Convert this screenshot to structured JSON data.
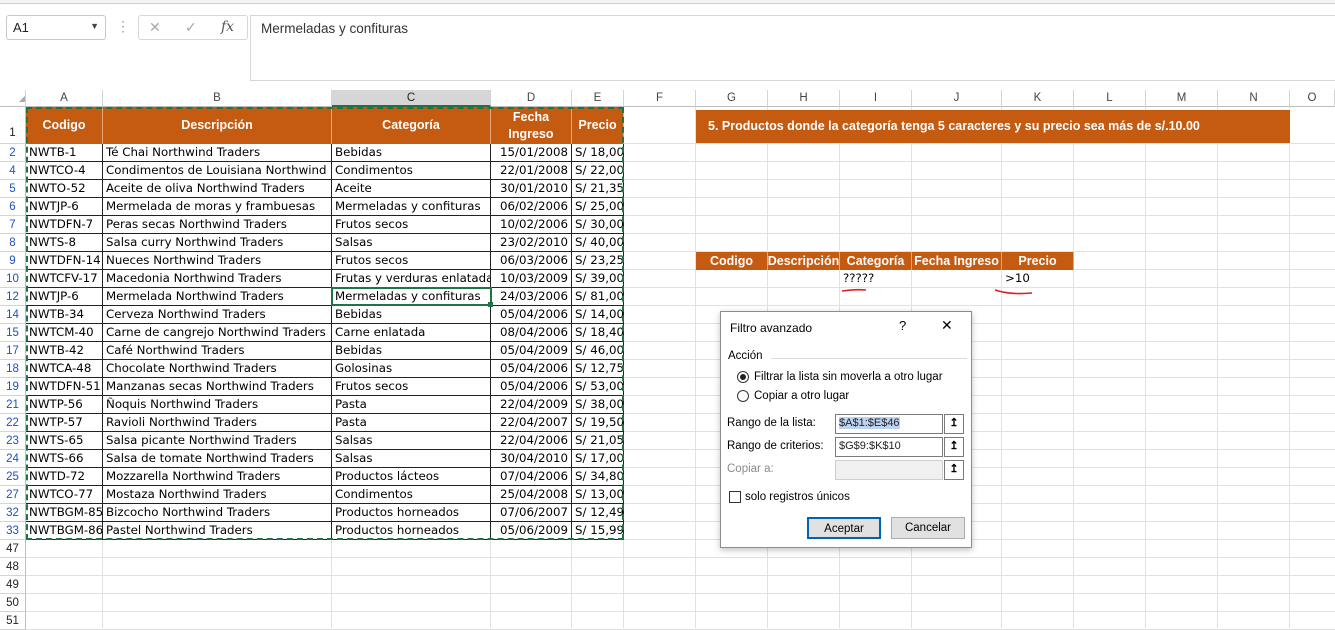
{
  "formula_bar": {
    "name_box": "A1",
    "cancel_icon": "✕",
    "enter_icon": "✓",
    "fx_label": "fx",
    "formula": "Mermeladas y confituras"
  },
  "columns": [
    "A",
    "B",
    "C",
    "D",
    "E",
    "F",
    "G",
    "H",
    "I",
    "J",
    "K",
    "L",
    "M",
    "N",
    "O"
  ],
  "table": {
    "headers": [
      "Codigo",
      "Descripción",
      "Categoría",
      "Fecha Ingreso",
      "Precio"
    ],
    "rows": [
      {
        "row": "2",
        "codigo": "NWTB-1",
        "descripcion": "Té Chai Northwind Traders",
        "categoria": "Bebidas",
        "fecha": "15/01/2008",
        "precio": "S/ 18,00"
      },
      {
        "row": "4",
        "codigo": "NWTCO-4",
        "descripcion": "Condimentos de Louisiana Northwind",
        "categoria": "Condimentos",
        "fecha": "22/01/2008",
        "precio": "S/ 22,00"
      },
      {
        "row": "5",
        "codigo": "NWTO-52",
        "descripcion": "Aceite de oliva Northwind Traders",
        "categoria": "Aceite",
        "fecha": "30/01/2010",
        "precio": "S/ 21,35"
      },
      {
        "row": "6",
        "codigo": "NWTJP-6",
        "descripcion": "Mermelada de moras y frambuesas",
        "categoria": "Mermeladas y confituras",
        "fecha": "06/02/2006",
        "precio": "S/ 25,00"
      },
      {
        "row": "7",
        "codigo": "NWTDFN-7",
        "descripcion": "Peras secas Northwind Traders",
        "categoria": "Frutos secos",
        "fecha": "10/02/2006",
        "precio": "S/ 30,00"
      },
      {
        "row": "8",
        "codigo": "NWTS-8",
        "descripcion": "Salsa curry Northwind Traders",
        "categoria": "Salsas",
        "fecha": "23/02/2010",
        "precio": "S/ 40,00"
      },
      {
        "row": "9",
        "codigo": "NWTDFN-14",
        "descripcion": "Nueces Northwind Traders",
        "categoria": "Frutos secos",
        "fecha": "06/03/2006",
        "precio": "S/ 23,25"
      },
      {
        "row": "10",
        "codigo": "NWTCFV-17",
        "descripcion": "Macedonia Northwind Traders",
        "categoria": "Frutas y verduras enlatadas",
        "fecha": "10/03/2009",
        "precio": "S/ 39,00"
      },
      {
        "row": "12",
        "codigo": "NWTJP-6",
        "descripcion": "Mermelada Northwind Traders",
        "categoria": "Mermeladas y confituras",
        "fecha": "24/03/2006",
        "precio": "S/ 81,00"
      },
      {
        "row": "14",
        "codigo": "NWTB-34",
        "descripcion": "Cerveza Northwind Traders",
        "categoria": "Bebidas",
        "fecha": "05/04/2006",
        "precio": "S/ 14,00"
      },
      {
        "row": "15",
        "codigo": "NWTCM-40",
        "descripcion": "Carne de cangrejo Northwind Traders",
        "categoria": "Carne enlatada",
        "fecha": "08/04/2006",
        "precio": "S/ 18,40"
      },
      {
        "row": "17",
        "codigo": "NWTB-42",
        "descripcion": "Café Northwind Traders",
        "categoria": "Bebidas",
        "fecha": "05/04/2009",
        "precio": "S/ 46,00"
      },
      {
        "row": "18",
        "codigo": "NWTCA-48",
        "descripcion": "Chocolate Northwind Traders",
        "categoria": "Golosinas",
        "fecha": "05/04/2006",
        "precio": "S/ 12,75"
      },
      {
        "row": "19",
        "codigo": "NWTDFN-51",
        "descripcion": "Manzanas secas Northwind Traders",
        "categoria": "Frutos secos",
        "fecha": "05/04/2006",
        "precio": "S/ 53,00"
      },
      {
        "row": "21",
        "codigo": "NWTP-56",
        "descripcion": "Ñoquis Northwind Traders",
        "categoria": "Pasta",
        "fecha": "22/04/2009",
        "precio": "S/ 38,00"
      },
      {
        "row": "22",
        "codigo": "NWTP-57",
        "descripcion": "Ravioli Northwind Traders",
        "categoria": "Pasta",
        "fecha": "22/04/2007",
        "precio": "S/ 19,50"
      },
      {
        "row": "23",
        "codigo": "NWTS-65",
        "descripcion": "Salsa picante Northwind Traders",
        "categoria": "Salsas",
        "fecha": "22/04/2006",
        "precio": "S/ 21,05"
      },
      {
        "row": "24",
        "codigo": "NWTS-66",
        "descripcion": "Salsa de tomate Northwind Traders",
        "categoria": "Salsas",
        "fecha": "30/04/2010",
        "precio": "S/ 17,00"
      },
      {
        "row": "25",
        "codigo": "NWTD-72",
        "descripcion": "Mozzarella Northwind Traders",
        "categoria": "Productos lácteos",
        "fecha": "07/04/2006",
        "precio": "S/ 34,80"
      },
      {
        "row": "27",
        "codigo": "NWTCO-77",
        "descripcion": "Mostaza Northwind Traders",
        "categoria": "Condimentos",
        "fecha": "25/04/2008",
        "precio": "S/ 13,00"
      },
      {
        "row": "32",
        "codigo": "NWTBGM-85",
        "descripcion": "Bizcocho Northwind Traders",
        "categoria": "Productos horneados",
        "fecha": "07/06/2007",
        "precio": "S/ 12,49"
      },
      {
        "row": "33",
        "codigo": "NWTBGM-86",
        "descripcion": "Pastel Northwind Traders",
        "categoria": "Productos horneados",
        "fecha": "05/06/2009",
        "precio": "S/ 15,99"
      }
    ],
    "trailing_rows": [
      "47",
      "48",
      "49",
      "50",
      "51"
    ]
  },
  "task_banner": "5.     Productos donde la categoría tenga 5 caracteres y su precio sea más de s/.10.00",
  "criteria": {
    "headers": [
      "Codigo",
      "Descripción",
      "Categoría",
      "Fecha Ingreso",
      "Precio"
    ],
    "categoria_value": "?????",
    "precio_value": ">10"
  },
  "dialog": {
    "title": "Filtro avanzado",
    "help": "?",
    "close": "✕",
    "section": "Acción",
    "radio1": "Filtrar la lista sin moverla a otro lugar",
    "radio2": "Copiar a otro lugar",
    "list_range_label": "Rango de la lista:",
    "list_range_value": "$A$1:$E$46",
    "criteria_range_label": "Rango de criterios:",
    "criteria_range_value": "$G$9:$K$10",
    "copy_to_label": "Copiar a:",
    "copy_to_value": "",
    "unique_label": "solo registros únicos",
    "ok": "Aceptar",
    "cancel": "Cancelar",
    "ref_icon": "↥"
  },
  "colors": {
    "header_bg": "#c55a11",
    "header_text": "#ffffff",
    "row_header_blue": "#1f4fc0",
    "annotation": "#e02020",
    "selection": "#217346"
  }
}
